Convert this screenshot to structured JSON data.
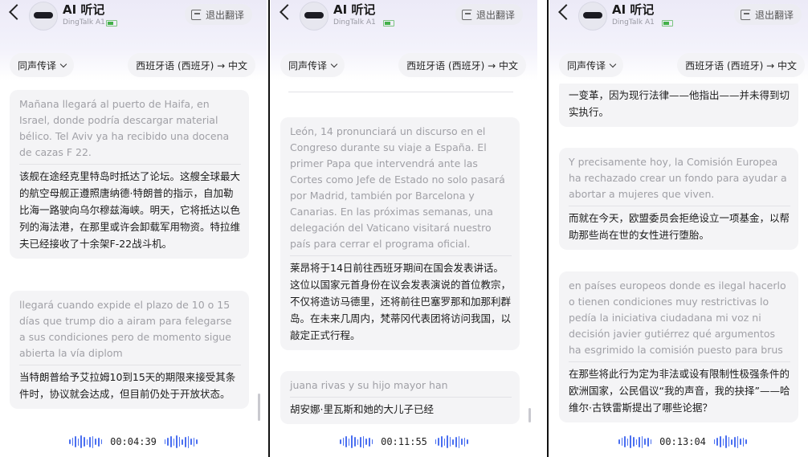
{
  "panels": [
    {
      "header": {
        "title": "AI 听记",
        "device": "DingTalk A1",
        "exit_label": "退出翻译"
      },
      "controls": {
        "mode": "同声传译",
        "languages": "西班牙语 (西班牙) → 中文"
      },
      "cards": [
        {
          "source": "Mañana llegará al puerto de Haifa, en Israel, donde podría descargar material bélico. Tel Aviv ya ha recibido una docena de cazas F 22.",
          "translation": "该舰在途经克里特岛时抵达了论坛。这艘全球最大的航空母舰正遵照唐纳德·特朗普的指示，自加勒比海一路驶向乌尔穆兹海峡。明天，它将抵达以色列的海法港，在那里或许会卸载军用物资。特拉维夫已经接收了十余架F-22战斗机。"
        },
        {
          "source": "llegará cuando expide el plazo de 10 o 15 días que trump dio a airam para felegarse a sus condiciones pero de momento sigue abierta la vía diplom",
          "translation": "当特朗普给予艾拉姆10到15天的期限来接受其条件时，协议就会达成，但目前仍处于开放状态。"
        }
      ],
      "timer": "00:04:39"
    },
    {
      "header": {
        "title": "AI 听记",
        "device": "DingTalk A1",
        "exit_label": "退出翻译"
      },
      "controls": {
        "mode": "同声传译",
        "languages": "西班牙语 (西班牙) → 中文"
      },
      "cards": [
        {
          "source": "León, 14 pronunciará un discurso en el Congreso durante su viaje a España. El primer Papa que intervendrá ante las Cortes como Jefe de Estado no solo pasará por Madrid, también por Barcelona y Canarias. En las próximas semanas, una delegación del Vaticano visitará nuestro país para cerrar el programa oficial.",
          "translation": "莱昂将于14日前往西班牙期间在国会发表讲话。这位以国家元首身份在议会发表演说的首位教宗，不仅将造访马德里，还将前往巴塞罗那和加那利群岛。在未来几周内，梵蒂冈代表团将访问我国，以敲定正式行程。"
        },
        {
          "source": "juana rivas y su hijo mayor han",
          "translation": "胡安娜·里瓦斯和她的大儿子已经"
        }
      ],
      "timer": "00:11:55"
    },
    {
      "header": {
        "title": "AI 听记",
        "device": "DingTalk A1",
        "exit_label": "退出翻译"
      },
      "controls": {
        "mode": "同声传译",
        "languages": "西班牙语 (西班牙) → 中文"
      },
      "cards": [
        {
          "source": "",
          "translation": "一变革，因为现行法律——他指出——并未得到切实执行。"
        },
        {
          "source": "Y precisamente hoy, la Comisión Europea ha rechazado crear un fondo para ayudar a abortar a mujeres que viven.",
          "translation": "而就在今天，欧盟委员会拒绝设立一项基金，以帮助那些尚在世的女性进行堕胎。"
        },
        {
          "source": "en países europeos donde es ilegal hacerlo o tienen condiciones muy restrictivas lo pedía la iniciativa ciudadana mi voz ni decisión javier gutiérrez qué argumentos ha esgrimido la comisión puesto para brus",
          "translation": "在那些将此行为定为非法或设有限制性极强条件的欧洲国家，公民倡议“我的声音，我的抉择”——哈维尔·古铁雷斯提出了哪些论据？"
        }
      ],
      "timer": "00:13:04"
    }
  ],
  "colors": {
    "accent_wave": "#4a6ff0",
    "battery": "#43b049",
    "card_bg": "#f4f4f6"
  },
  "icons": {
    "back": "chevron-left-icon",
    "exit": "exit-icon",
    "dropdown": "chevron-down-icon"
  }
}
